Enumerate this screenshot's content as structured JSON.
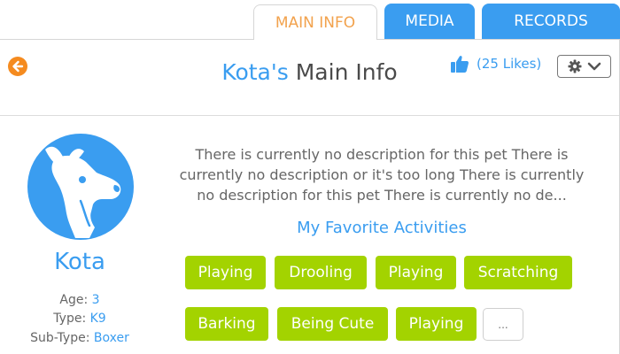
{
  "tabs": [
    {
      "label": "MAIN INFO",
      "active": true
    },
    {
      "label": "MEDIA",
      "active": false
    },
    {
      "label": "RECORDS",
      "active": false
    }
  ],
  "header": {
    "title_pet": "Kota's",
    "title_rest": "Main Info",
    "likes": "(25 Likes)"
  },
  "icons": {
    "back": "back-arrow-icon",
    "likes": "thumbs-up-icon",
    "settings": "gear-icon",
    "dropdown": "chevron-down-icon",
    "avatar": "dog-head-icon"
  },
  "profile": {
    "name": "Kota",
    "age_label": "Age:",
    "age": "3",
    "type_label": "Type:",
    "type": "K9",
    "subtype_label": "Sub-Type:",
    "subtype": "Boxer"
  },
  "description": "There is currently no description for this pet There is currently no description or it's too long There is currently no description for this pet There is currently no de...",
  "favorites": {
    "title": "My Favorite Activities",
    "activities": [
      "Playing",
      "Drooling",
      "Playing",
      "Scratching",
      "Barking",
      "Being Cute",
      "Playing"
    ],
    "more_label": "..."
  },
  "colors": {
    "accent_blue": "#3a9df0",
    "accent_orange": "#f58b1f",
    "chip_green": "#a3d300"
  }
}
